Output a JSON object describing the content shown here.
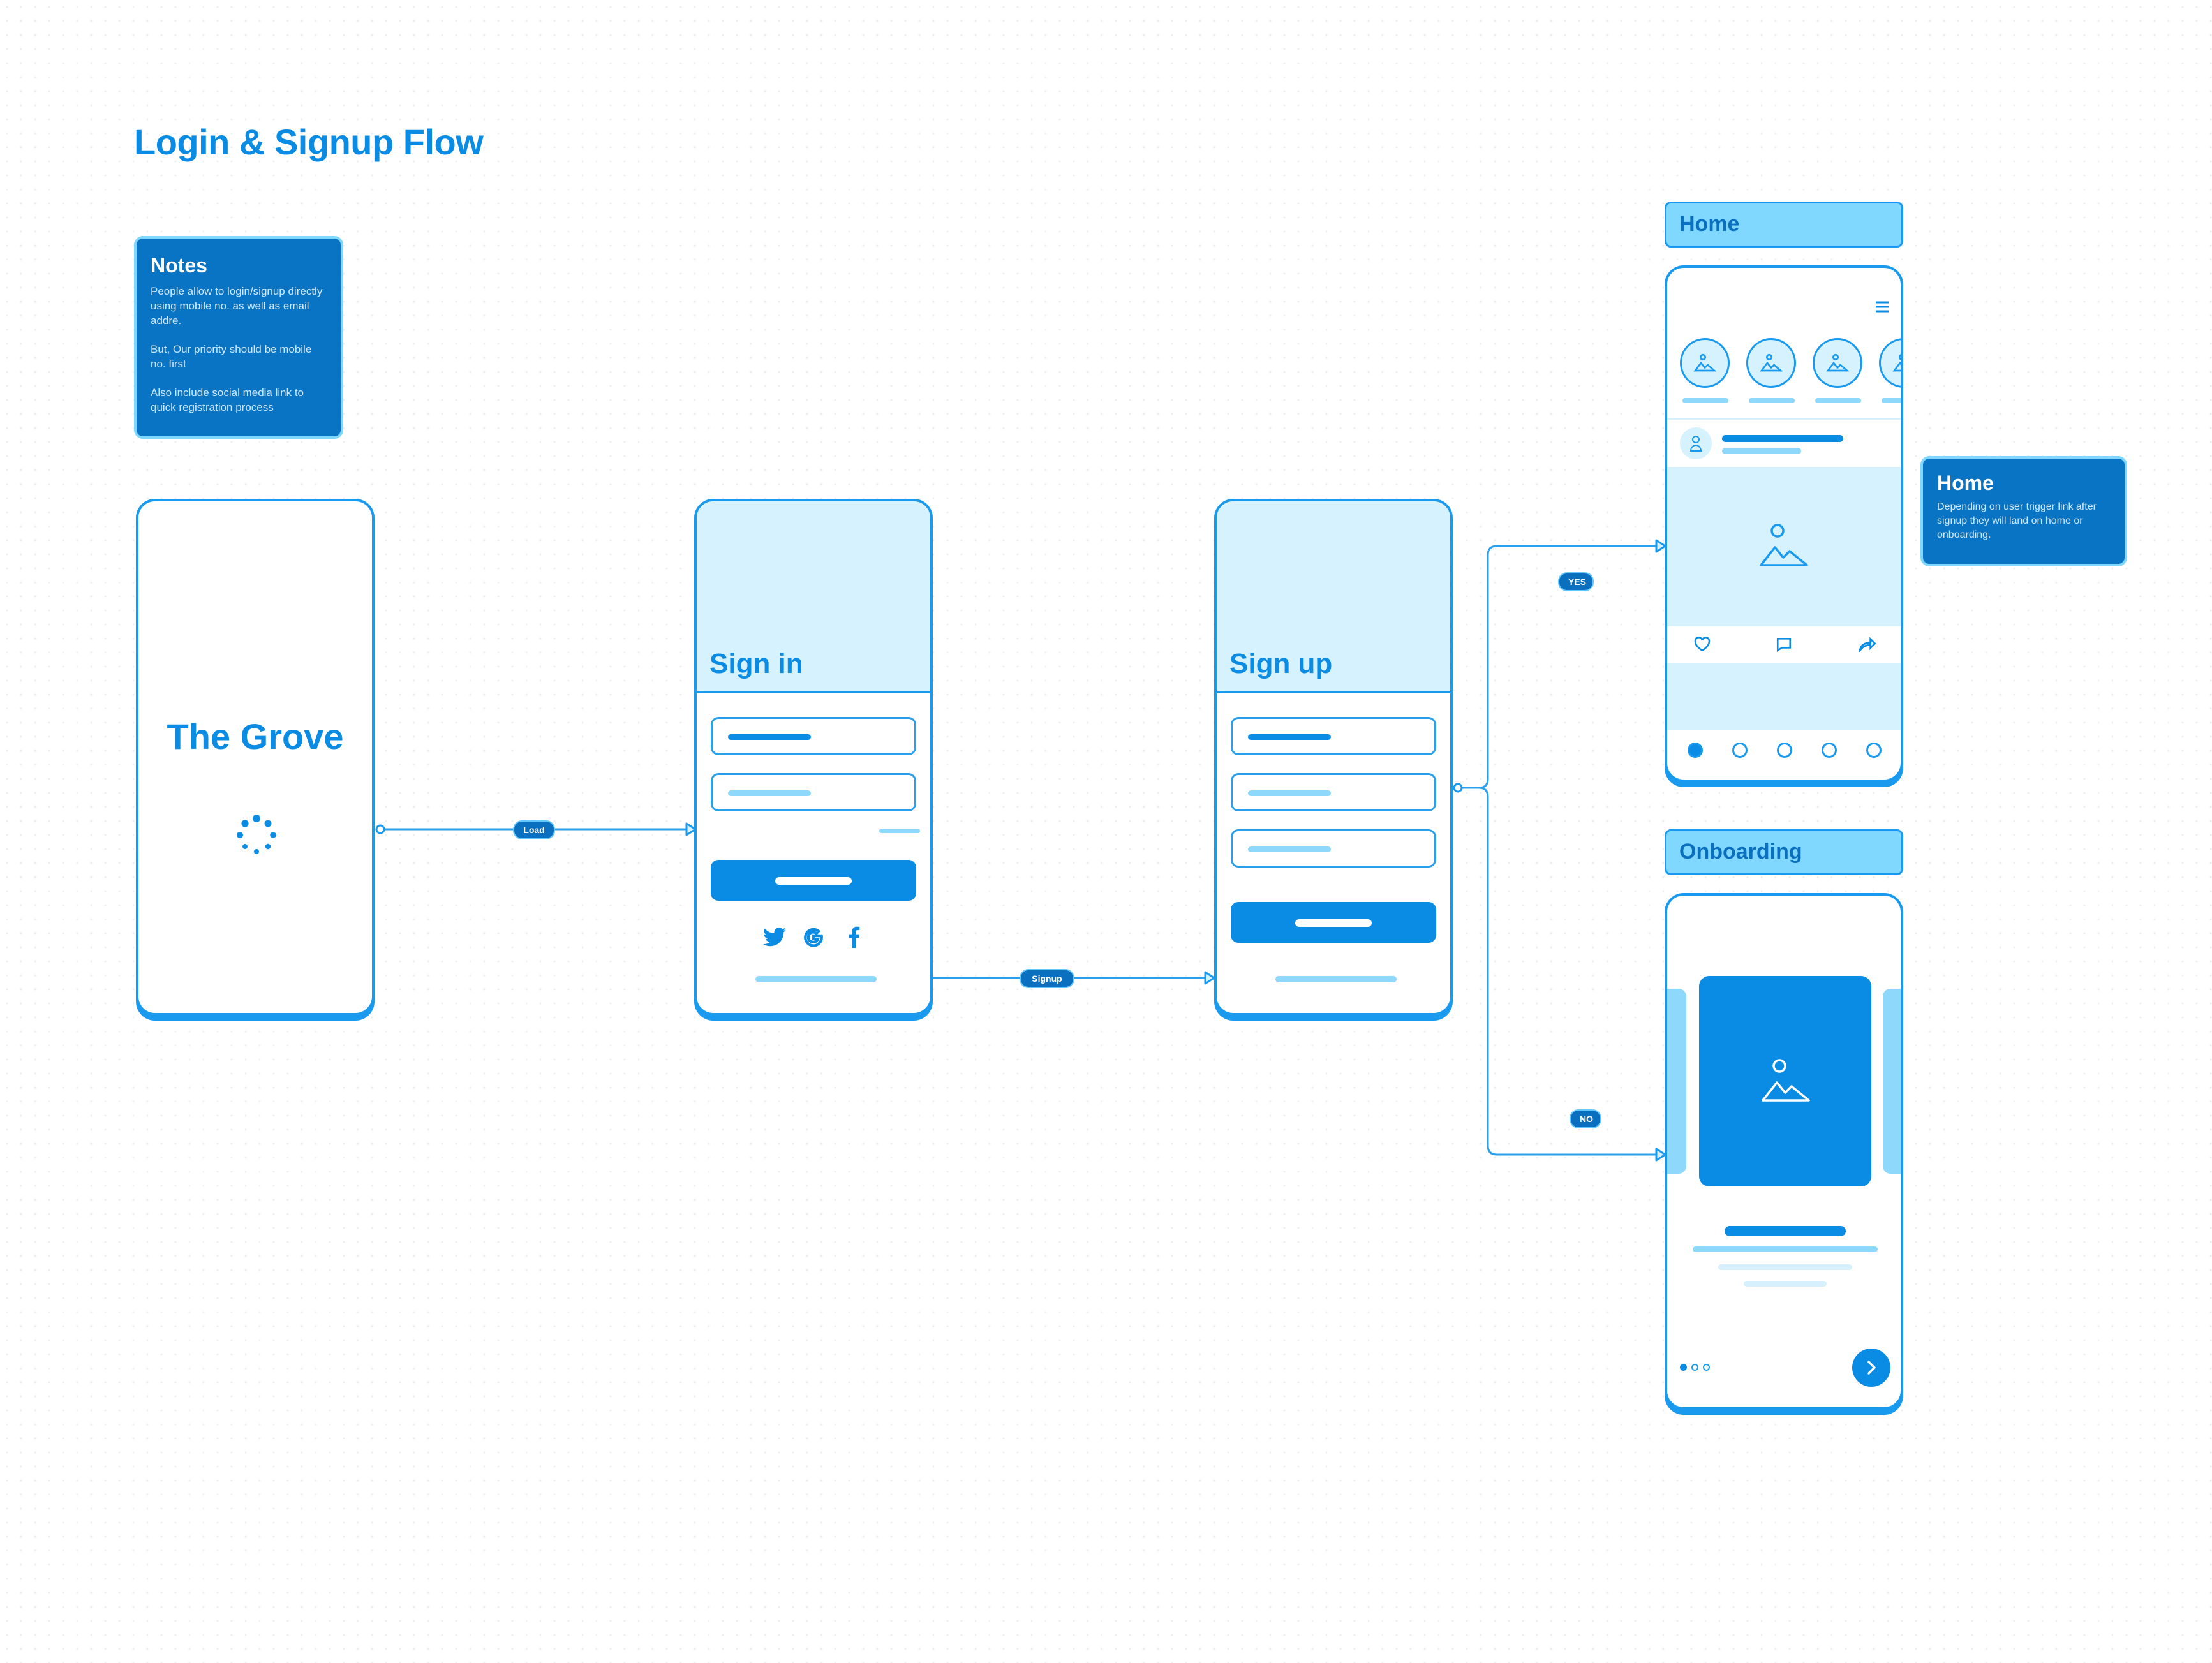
{
  "page": {
    "title": "Login & Signup Flow"
  },
  "notes_card": {
    "title": "Notes",
    "paragraphs": [
      "People allow to login/signup directly using mobile no. as well as email addre.",
      "But, Our priority should be mobile no. first",
      "Also include social media link to quick registration process"
    ]
  },
  "home_note": {
    "title": "Home",
    "text": "Depending on user trigger link after signup they will land on home or onboarding."
  },
  "screens": {
    "splash": {
      "app_name": "The Grove"
    },
    "signin": {
      "title": "Sign in",
      "social": [
        "twitter-icon",
        "google-icon",
        "facebook-icon"
      ]
    },
    "signup": {
      "title": "Sign up"
    },
    "home": {
      "label": "Home"
    },
    "onboarding": {
      "label": "Onboarding"
    }
  },
  "connectors": {
    "load": "Load",
    "signup": "Signup",
    "yes": "YES",
    "no": "NO"
  },
  "colors": {
    "primary": "#0a8be4",
    "light": "#8dd8fb",
    "panel": "#d6f2fe",
    "note_bg": "#0a74c4"
  }
}
